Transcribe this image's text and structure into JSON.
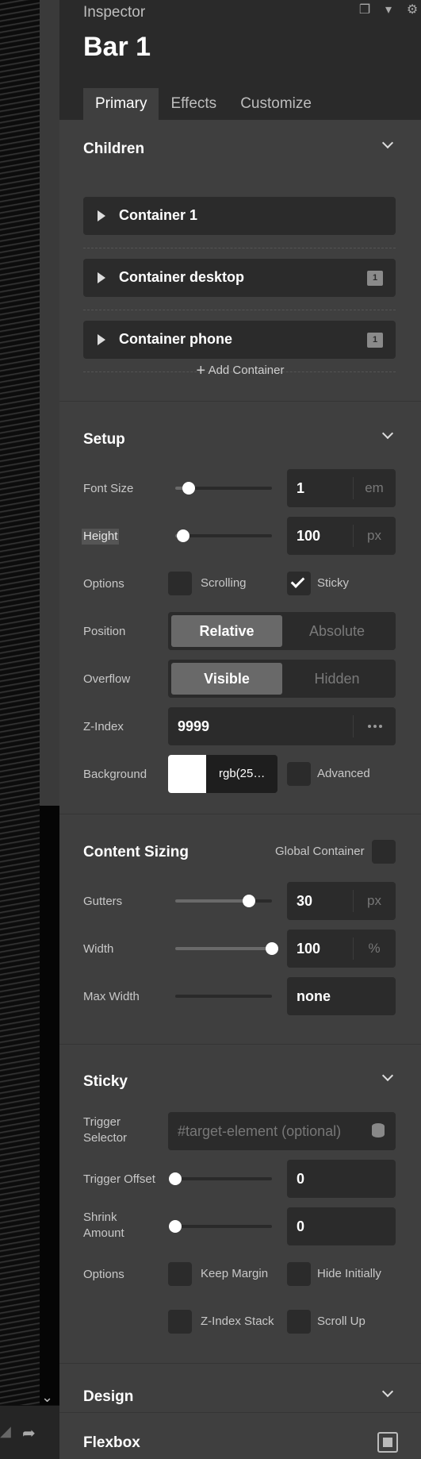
{
  "inspector": {
    "title": "Inspector",
    "element_name": "Bar 1",
    "header_icons": [
      "copy-icon",
      "delete-icon",
      "settings-icon"
    ],
    "tabs": [
      {
        "label": "Primary",
        "active": true
      },
      {
        "label": "Effects",
        "active": false
      },
      {
        "label": "Customize",
        "active": false
      }
    ]
  },
  "children": {
    "title": "Children",
    "items": [
      {
        "label": "Container 1",
        "badge": ""
      },
      {
        "label": "Container desktop",
        "badge": "1"
      },
      {
        "label": "Container phone",
        "badge": "1"
      }
    ],
    "add_label": "Add Container"
  },
  "setup": {
    "title": "Setup",
    "font_size": {
      "label": "Font Size",
      "value": "1",
      "unit": "em",
      "slider": 0.14
    },
    "height": {
      "label": "Height",
      "value": "100",
      "unit": "px",
      "slider": 0.08
    },
    "options": {
      "label": "Options",
      "scrolling": {
        "label": "Scrolling",
        "checked": false
      },
      "sticky": {
        "label": "Sticky",
        "checked": true
      }
    },
    "position": {
      "label": "Position",
      "options": [
        "Relative",
        "Absolute"
      ],
      "selected": "Relative"
    },
    "overflow": {
      "label": "Overflow",
      "options": [
        "Visible",
        "Hidden"
      ],
      "selected": "Visible"
    },
    "z_index": {
      "label": "Z-Index",
      "value": "9999"
    },
    "background": {
      "label": "Background",
      "value": "rgb(25…",
      "color": "#ffffff",
      "advanced": {
        "label": "Advanced",
        "checked": false
      }
    }
  },
  "content_sizing": {
    "title": "Content Sizing",
    "global_container": {
      "label": "Global Container",
      "checked": false
    },
    "gutters": {
      "label": "Gutters",
      "value": "30",
      "unit": "px",
      "slider": 0.76
    },
    "width": {
      "label": "Width",
      "value": "100",
      "unit": "%",
      "slider": 1.0
    },
    "max_width": {
      "label": "Max Width",
      "value": "none"
    }
  },
  "sticky": {
    "title": "Sticky",
    "trigger_selector": {
      "label": "Trigger Selector",
      "placeholder": "#target-element (optional)"
    },
    "trigger_offset": {
      "label": "Trigger Offset",
      "value": "0",
      "slider": 0.0
    },
    "shrink_amount": {
      "label": "Shrink Amount",
      "value": "0",
      "slider": 0.0
    },
    "options": {
      "label": "Options",
      "keep_margin": {
        "label": "Keep Margin",
        "checked": false
      },
      "hide_initially": {
        "label": "Hide Initially",
        "checked": false
      },
      "z_index_stack": {
        "label": "Z-Index Stack",
        "checked": false
      },
      "scroll_up": {
        "label": "Scroll Up",
        "checked": false
      }
    }
  },
  "design": {
    "title": "Design"
  },
  "flexbox": {
    "title": "Flexbox"
  },
  "colors": {
    "panel": "#3f3f3f",
    "header": "#2a2a2a",
    "field": "#2b2b2b",
    "accent_selected": "#696969"
  }
}
